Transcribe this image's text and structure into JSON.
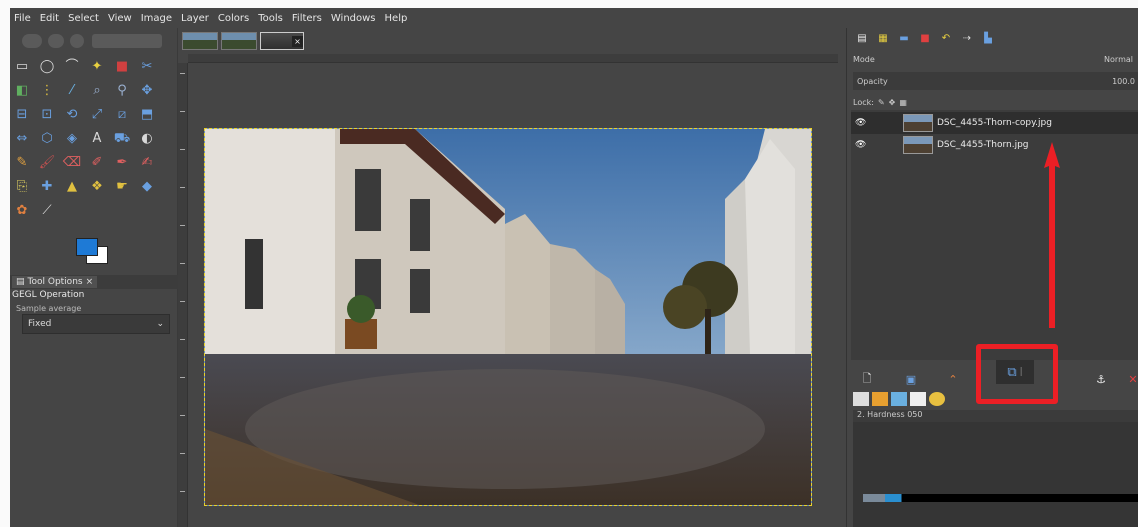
{
  "menubar": {
    "items": [
      "File",
      "Edit",
      "Select",
      "View",
      "Image",
      "Layer",
      "Colors",
      "Tools",
      "Filters",
      "Windows",
      "Help"
    ]
  },
  "toolbox": {
    "tools": [
      {
        "icon": "rect-select-icon",
        "glyph": "▭",
        "color": "#d8d8d8"
      },
      {
        "icon": "ellipse-select-icon",
        "glyph": "◯",
        "color": "#d8d8d8"
      },
      {
        "icon": "free-select-icon",
        "glyph": "⌒",
        "color": "#d8d8d8"
      },
      {
        "icon": "fuzzy-select-icon",
        "glyph": "✦",
        "color": "#e8d040"
      },
      {
        "icon": "by-color-select-icon",
        "glyph": "■",
        "color": "#d04040"
      },
      {
        "icon": "scissors-icon",
        "glyph": "✂",
        "color": "#6aa0e0"
      },
      {
        "icon": "foreground-select-icon",
        "glyph": "◧",
        "color": "#60b060"
      },
      {
        "icon": "paths-icon",
        "glyph": "⋮",
        "color": "#e0c040"
      },
      {
        "icon": "color-picker-icon",
        "glyph": "⁄",
        "color": "#6ab0e0"
      },
      {
        "icon": "zoom-icon",
        "glyph": "⌕",
        "color": "#9ab0d0"
      },
      {
        "icon": "measure-icon",
        "glyph": "⚲",
        "color": "#9ab0d0"
      },
      {
        "icon": "move-icon",
        "glyph": "✥",
        "color": "#6aa0e0"
      },
      {
        "icon": "align-icon",
        "glyph": "⊟",
        "color": "#6aa0e0"
      },
      {
        "icon": "crop-icon",
        "glyph": "⊡",
        "color": "#6aa0e0"
      },
      {
        "icon": "rotate-icon",
        "glyph": "⟲",
        "color": "#6aa0e0"
      },
      {
        "icon": "scale-icon",
        "glyph": "⤢",
        "color": "#6aa0e0"
      },
      {
        "icon": "shear-icon",
        "glyph": "⧄",
        "color": "#6aa0e0"
      },
      {
        "icon": "perspective-icon",
        "glyph": "⬒",
        "color": "#6aa0e0"
      },
      {
        "icon": "flip-icon",
        "glyph": "⇔",
        "color": "#6aa0e0"
      },
      {
        "icon": "cage-icon",
        "glyph": "⬡",
        "color": "#6aa0e0"
      },
      {
        "icon": "warp-icon",
        "glyph": "◈",
        "color": "#6aa0e0"
      },
      {
        "icon": "text-icon",
        "glyph": "A",
        "color": "#d8d8d8"
      },
      {
        "icon": "bucket-fill-icon",
        "glyph": "⛟",
        "color": "#6aa0e0"
      },
      {
        "icon": "blend-icon",
        "glyph": "◐",
        "color": "#d8d8d8"
      },
      {
        "icon": "pencil-icon",
        "glyph": "✎",
        "color": "#e0a040"
      },
      {
        "icon": "paintbrush-icon",
        "glyph": "🖌",
        "color": "#c05050"
      },
      {
        "icon": "eraser-icon",
        "glyph": "⌫",
        "color": "#e06060"
      },
      {
        "icon": "airbrush-icon",
        "glyph": "✐",
        "color": "#e06060"
      },
      {
        "icon": "ink-icon",
        "glyph": "✒",
        "color": "#e06060"
      },
      {
        "icon": "mypaint-brush-icon",
        "glyph": "✍",
        "color": "#e06060"
      },
      {
        "icon": "clone-icon",
        "glyph": "⎘",
        "color": "#e0d060"
      },
      {
        "icon": "heal-icon",
        "glyph": "✚",
        "color": "#6aa0e0"
      },
      {
        "icon": "perspective-clone-icon",
        "glyph": "▲",
        "color": "#e0c040"
      },
      {
        "icon": "blur-icon",
        "glyph": "❖",
        "color": "#e0c040"
      },
      {
        "icon": "smudge-icon",
        "glyph": "☛",
        "color": "#e0c040"
      },
      {
        "icon": "dodge-burn-icon",
        "glyph": "◆",
        "color": "#6aa0e0"
      },
      {
        "icon": "gegl-operation-icon",
        "glyph": "✿",
        "color": "#e08040"
      },
      {
        "icon": "eyedropper-icon",
        "glyph": "⟋",
        "color": "#d8d8d8"
      }
    ],
    "options_tab_label": "Tool Options",
    "options_title": "GEGL Operation",
    "options_subtitle": "Sample average",
    "options_value": "Fixed"
  },
  "image_window": {
    "tabs": [
      {
        "name": "image-tab-1"
      },
      {
        "name": "image-tab-2"
      },
      {
        "name": "image-tab-3",
        "close": "×"
      }
    ]
  },
  "layers": {
    "mode_label": "Mode",
    "mode_value": "Normal",
    "opacity_label": "Opacity",
    "opacity_value": "100.0",
    "lock_label": "Lock:",
    "items": [
      {
        "name": "DSC_4455-Thorn-copy.jpg",
        "visible": "👁",
        "selected": true
      },
      {
        "name": "DSC_4455-Thorn.jpg",
        "visible": "👁",
        "selected": false
      }
    ]
  },
  "brushes": {
    "header": "2. Hardness 050"
  },
  "accent": {
    "highlight": "#ec1f25",
    "fg_color": "#1e7ad6",
    "bg_color": "#ffffff"
  }
}
